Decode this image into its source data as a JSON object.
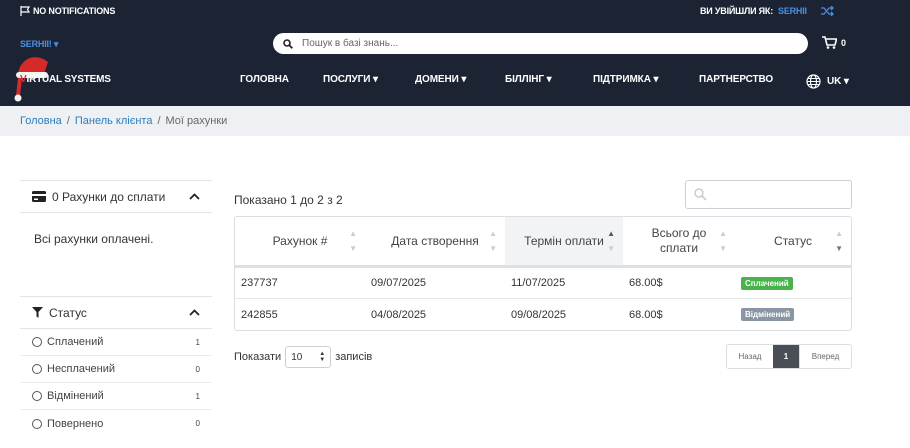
{
  "topbar": {
    "notifications_label": "NO NOTIFICATIONS",
    "logged_in_label": "ВИ УВІЙШЛИ ЯК:",
    "logged_in_user": "SERHII",
    "account_menu": "SERHII! ▾",
    "search_placeholder": "Пошук в базі знань...",
    "cart_count": "0",
    "logo_v": "V",
    "logo_rest": "IRTUAL SYSTEMS"
  },
  "nav": {
    "items": [
      {
        "label": "ГОЛОВНА"
      },
      {
        "label": "ПОСЛУГИ ▾"
      },
      {
        "label": "ДОМЕНИ ▾"
      },
      {
        "label": "БІЛЛІНГ ▾"
      },
      {
        "label": "ПІДТРИМКА ▾"
      },
      {
        "label": "ПАРТНЕРСТВО"
      },
      {
        "label": "UK ▾"
      }
    ]
  },
  "breadcrumb": {
    "home": "Головна",
    "client_area": "Панель клієнта",
    "current": "Мої рахунки"
  },
  "sidebar": {
    "due_title": "0 Рахунки до сплати",
    "due_body": "Всі рахунки оплачені.",
    "status_title": "Статус",
    "filters": [
      {
        "label": "Сплачений",
        "count": "1"
      },
      {
        "label": "Несплачений",
        "count": "0"
      },
      {
        "label": "Відмінений",
        "count": "1"
      },
      {
        "label": "Повернено",
        "count": "0"
      }
    ]
  },
  "table": {
    "info": "Показано 1 до 2 з 2",
    "columns": [
      {
        "label": "Рахунок #"
      },
      {
        "label": "Дата створення"
      },
      {
        "label": "Термін оплати"
      },
      {
        "label": "Всього до сплати"
      },
      {
        "label": "Статус"
      }
    ],
    "rows": [
      {
        "invoice": "237737",
        "created": "09/07/2025",
        "due": "11/07/2025",
        "total": "68.00$",
        "status": "Сплачений"
      },
      {
        "invoice": "242855",
        "created": "04/08/2025",
        "due": "09/08/2025",
        "total": "68.00$",
        "status": "Відмінений"
      }
    ],
    "length_prefix": "Показати",
    "length_value": "10",
    "length_suffix": "записів",
    "prev": "Назад",
    "page": "1",
    "next": "Вперед"
  },
  "colors": {
    "header_bg": "#1c2434",
    "accent": "#4a90e2",
    "paid": "#47b34a",
    "cancelled": "#8a96a3"
  }
}
